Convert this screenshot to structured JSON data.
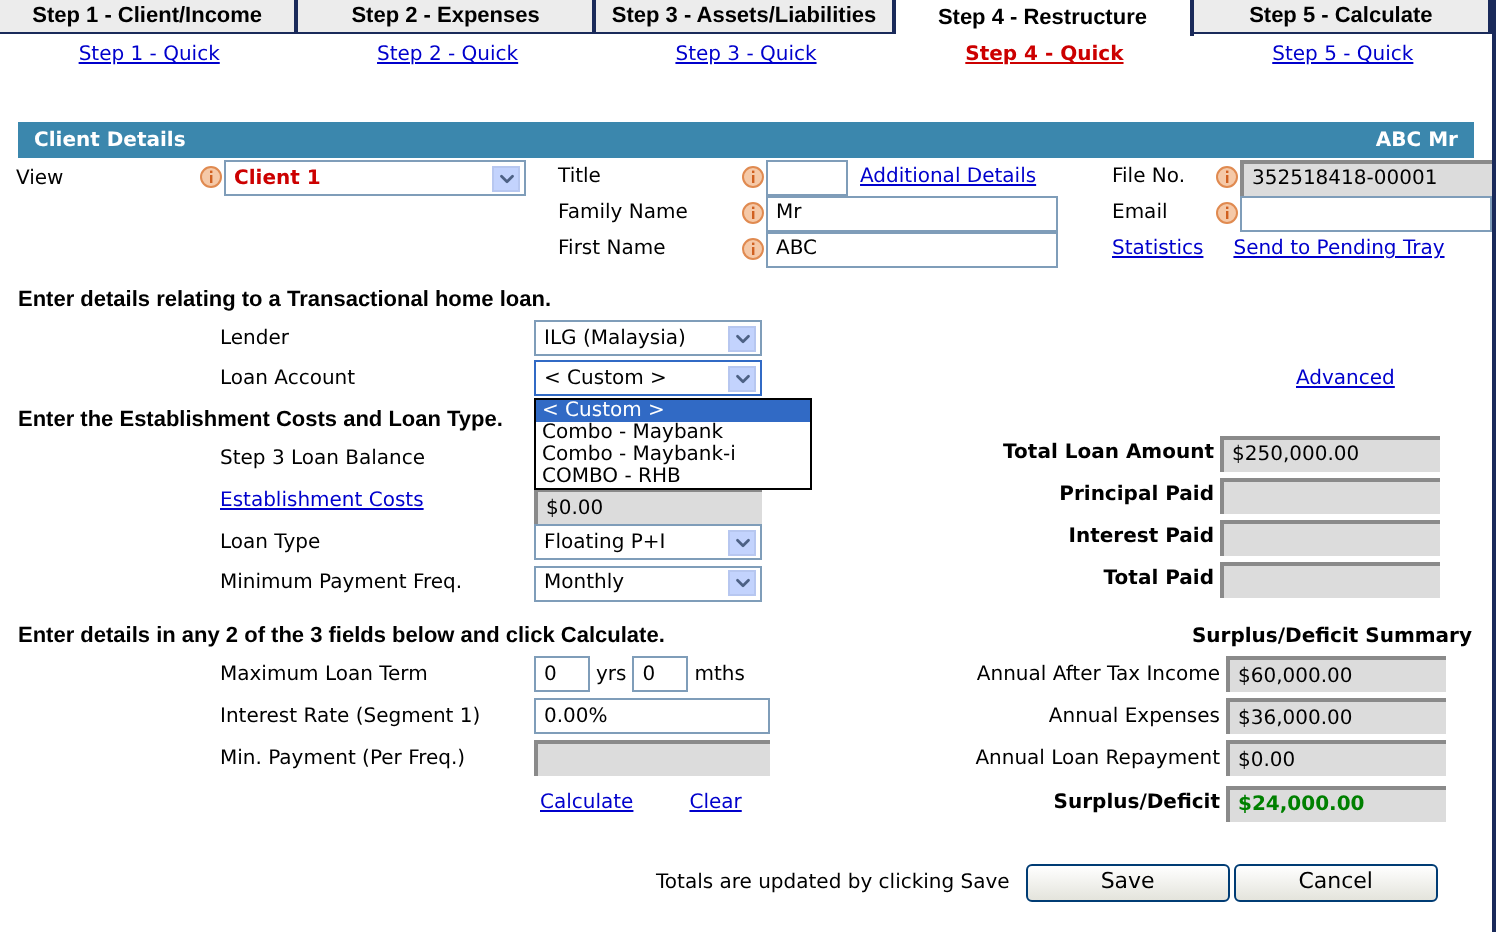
{
  "tabs": [
    {
      "label": "Step 1 - Client/Income",
      "selected": false
    },
    {
      "label": "Step 2 - Expenses",
      "selected": false
    },
    {
      "label": "Step 3 - Assets/Liabilities",
      "selected": false
    },
    {
      "label": "Step 4 - Restructure",
      "selected": true
    },
    {
      "label": "Step 5 - Calculate",
      "selected": false
    }
  ],
  "quick_links": [
    {
      "label": "Step 1 - Quick",
      "selected": false
    },
    {
      "label": "Step 2 - Quick",
      "selected": false
    },
    {
      "label": "Step 3 - Quick",
      "selected": false
    },
    {
      "label": "Step 4 - Quick",
      "selected": true
    },
    {
      "label": "Step 5 - Quick",
      "selected": false
    }
  ],
  "client_details": {
    "title": "Client Details",
    "client": "ABC Mr",
    "view": {
      "label": "View",
      "value": "Client 1"
    },
    "title_field": {
      "label": "Title"
    },
    "additional_details": "Additional Details",
    "family_name": {
      "label": "Family Name",
      "value": "Mr"
    },
    "first_name": {
      "label": "First Name",
      "value": "ABC"
    },
    "file_no": {
      "label": "File No.",
      "value": "352518418-00001"
    },
    "email": {
      "label": "Email"
    },
    "statistics": "Statistics",
    "send_to_pending": "Send to Pending Tray"
  },
  "loan_section": {
    "heading": "Enter details relating to a Transactional home loan.",
    "lender": {
      "label": "Lender",
      "value": "ILG (Malaysia)"
    },
    "loan_account": {
      "label": "Loan Account",
      "value": "< Custom >",
      "expanded": true,
      "options": [
        {
          "label": "< Custom >",
          "selected": true
        },
        {
          "label": "Combo - Maybank",
          "selected": false
        },
        {
          "label": "Combo - Maybank-i",
          "selected": false
        },
        {
          "label": "COMBO - RHB",
          "selected": false
        }
      ]
    },
    "advanced": "Advanced"
  },
  "costs_section": {
    "heading": "Enter the Establishment Costs and Loan Type.",
    "step3_balance": {
      "label": "Step 3 Loan Balance"
    },
    "establishment_costs": {
      "label": "Establishment Costs",
      "value": "$0.00"
    },
    "loan_type": {
      "label": "Loan Type",
      "value": "Floating P+I"
    },
    "payment_freq": {
      "label": "Minimum Payment Freq.",
      "value": "Monthly"
    },
    "totals": [
      {
        "label": "Total Loan Amount",
        "value": "$250,000.00"
      },
      {
        "label": "Principal Paid"
      },
      {
        "label": "Interest Paid"
      },
      {
        "label": "Total Paid"
      }
    ]
  },
  "calc_section": {
    "heading": "Enter details in any 2 of the 3 fields below and click Calculate.",
    "loan_term": {
      "label": "Maximum Loan Term",
      "years": "0",
      "years_unit": "yrs",
      "months": "0",
      "months_unit": "mths"
    },
    "interest_rate": {
      "label": "Interest Rate (Segment 1)",
      "value": "0.00%",
      "readonly": false
    },
    "min_payment": {
      "label": "Min. Payment (Per Freq.)",
      "readonly": true
    },
    "calculate": "Calculate",
    "clear": "Clear",
    "summary_title": "Surplus/Deficit Summary",
    "summary": [
      {
        "label": "Annual After Tax Income",
        "value": "$60,000.00",
        "kind": "plain"
      },
      {
        "label": "Annual Expenses",
        "value": "$36,000.00",
        "kind": "plain"
      },
      {
        "label": "Annual Loan Repayment",
        "value": "$0.00",
        "kind": "plain"
      },
      {
        "label": "Surplus/Deficit",
        "value": "$24,000.00",
        "kind": "total"
      }
    ]
  },
  "footer": {
    "note": "Totals are updated by clicking Save",
    "buttons": [
      "Save",
      "Cancel"
    ]
  }
}
